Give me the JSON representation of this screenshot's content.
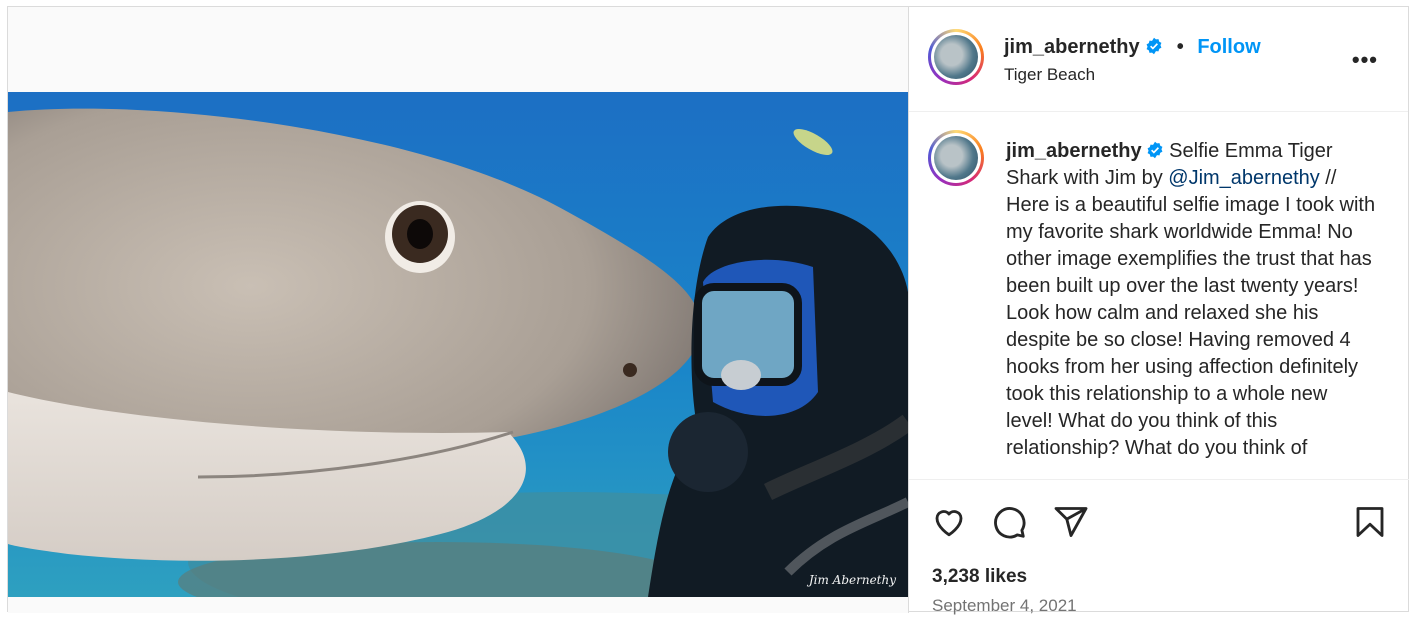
{
  "post": {
    "username": "jim_abernethy",
    "location": "Tiger Beach",
    "follow_label": "Follow",
    "separator": "•",
    "more_label": "•••",
    "watermark": "Jim Abernethy",
    "caption": {
      "part1": "Selfie Emma Tiger Shark with Jim by ",
      "mention": "@Jim_abernethy",
      "part2": " // Here is a beautiful selfie image I took with my favorite shark worldwide Emma! No other image exemplifies the trust that has been built up over the last twenty years! Look how calm and relaxed she his despite be so close! Having removed 4 hooks from her using affection definitely took this relationship to a whole new level! What do you think of this relationship? What do you think of"
    },
    "likes": "3,238 likes",
    "date": "September 4, 2021"
  },
  "icons": [
    "verified-badge-icon",
    "more-options-icon",
    "heart-icon",
    "comment-icon",
    "share-icon",
    "bookmark-icon"
  ],
  "colors": {
    "link_blue": "#0095f6",
    "mention": "#00376b",
    "text": "#262626",
    "muted": "#737373"
  }
}
